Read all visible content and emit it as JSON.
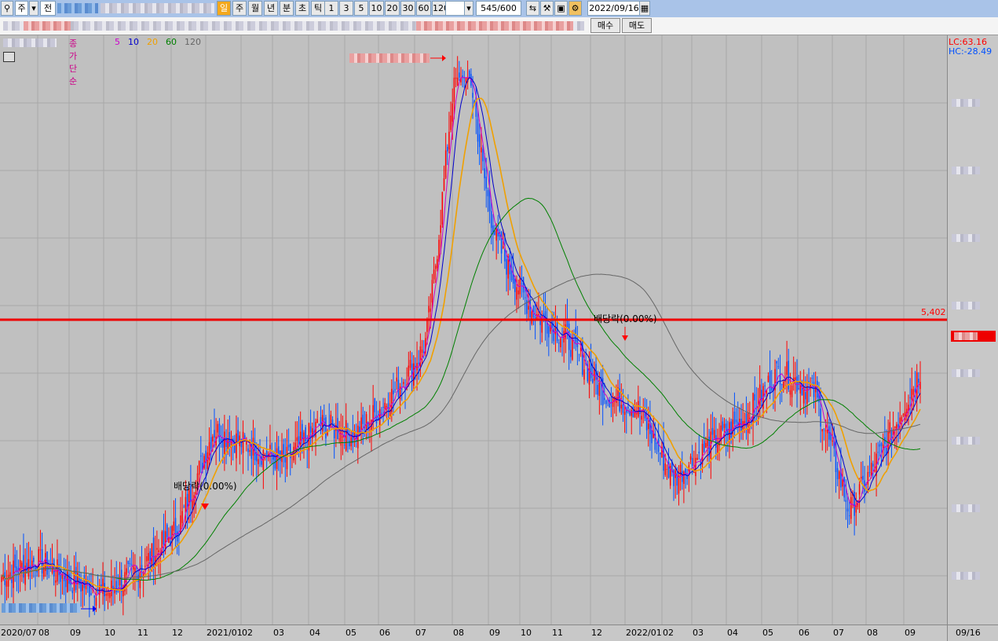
{
  "toolbar": {
    "ticker_kind": "주",
    "ticker_prefix": "전",
    "period_buttons": [
      {
        "label": "일",
        "selected": true
      },
      {
        "label": "주",
        "selected": false
      },
      {
        "label": "월",
        "selected": false
      },
      {
        "label": "년",
        "selected": false
      },
      {
        "label": "분",
        "selected": false
      },
      {
        "label": "초",
        "selected": false
      },
      {
        "label": "틱",
        "selected": false
      }
    ],
    "interval_buttons": [
      "1",
      "3",
      "5",
      "10",
      "20",
      "30",
      "60",
      "120"
    ],
    "count_display": "545/600",
    "date": "2022/09/16",
    "icons": [
      "arrows-icon",
      "wrench-icon",
      "save-icon",
      "gear-icon",
      "calendar-icon"
    ]
  },
  "order_buttons": {
    "buy": "매수",
    "sell": "매도"
  },
  "legend": {
    "prefix": "종가 단순",
    "periods": [
      {
        "label": "5",
        "color": "#cc00cc"
      },
      {
        "label": "10",
        "color": "#0000cc"
      },
      {
        "label": "20",
        "color": "#f0a000"
      },
      {
        "label": "60",
        "color": "#008000"
      },
      {
        "label": "120",
        "color": "#666666"
      }
    ]
  },
  "price_panel": {
    "lc_label": "LC:63.16",
    "hc_label": "HC:-28.49",
    "current_price_label": "5,402"
  },
  "annotations": {
    "dividend_1": "배당락(0.00%)",
    "dividend_2": "배당락(0.00%)"
  },
  "x_axis_labels": [
    "2020/07",
    "08",
    "09",
    "10",
    "11",
    "12",
    "2021/01",
    "02",
    "03",
    "04",
    "05",
    "06",
    "07",
    "08",
    "09",
    "10",
    "11",
    "12",
    "2022/01",
    "02",
    "03",
    "04",
    "05",
    "06",
    "07",
    "08",
    "09"
  ],
  "x_axis_right_label": "09/16",
  "colors": {
    "up": "#ff0000",
    "down": "#0050ff",
    "hline": "#ee0000",
    "background": "#c0c0c0"
  },
  "chart_data": {
    "type": "candlestick",
    "title": "",
    "xlabel": "",
    "ylabel": "",
    "date_range": [
      "2020/07",
      "2022/09/16"
    ],
    "marked_price": 5402,
    "moving_averages": [
      "5",
      "10",
      "20",
      "60",
      "120"
    ],
    "close_series_note": "",
    "close_relative": [
      {
        "month": "2020/07",
        "v": 0.06
      },
      {
        "month": "2020/08",
        "v": 0.09
      },
      {
        "month": "2020/09",
        "v": 0.05
      },
      {
        "month": "2020/10",
        "v": 0.03
      },
      {
        "month": "2020/11",
        "v": 0.08
      },
      {
        "month": "2020/12",
        "v": 0.15
      },
      {
        "month": "2021/01",
        "v": 0.33
      },
      {
        "month": "2021/02",
        "v": 0.3
      },
      {
        "month": "2021/03",
        "v": 0.27
      },
      {
        "month": "2021/04",
        "v": 0.34
      },
      {
        "month": "2021/05",
        "v": 0.32
      },
      {
        "month": "2021/06",
        "v": 0.39
      },
      {
        "month": "2021/07",
        "v": 0.48
      },
      {
        "month": "2021/08",
        "v": 0.85
      },
      {
        "month": "2021/09",
        "v": 0.67
      },
      {
        "month": "2021/10",
        "v": 0.55
      },
      {
        "month": "2021/11",
        "v": 0.5
      },
      {
        "month": "2021/12",
        "v": 0.4
      },
      {
        "month": "2022/01",
        "v": 0.37
      },
      {
        "month": "2022/02",
        "v": 0.24
      },
      {
        "month": "2022/03",
        "v": 0.3
      },
      {
        "month": "2022/04",
        "v": 0.35
      },
      {
        "month": "2022/05",
        "v": 0.44
      },
      {
        "month": "2022/06",
        "v": 0.4
      },
      {
        "month": "2022/07",
        "v": 0.18
      },
      {
        "month": "2022/08",
        "v": 0.3
      },
      {
        "month": "2022/09",
        "v": 0.44
      }
    ]
  }
}
